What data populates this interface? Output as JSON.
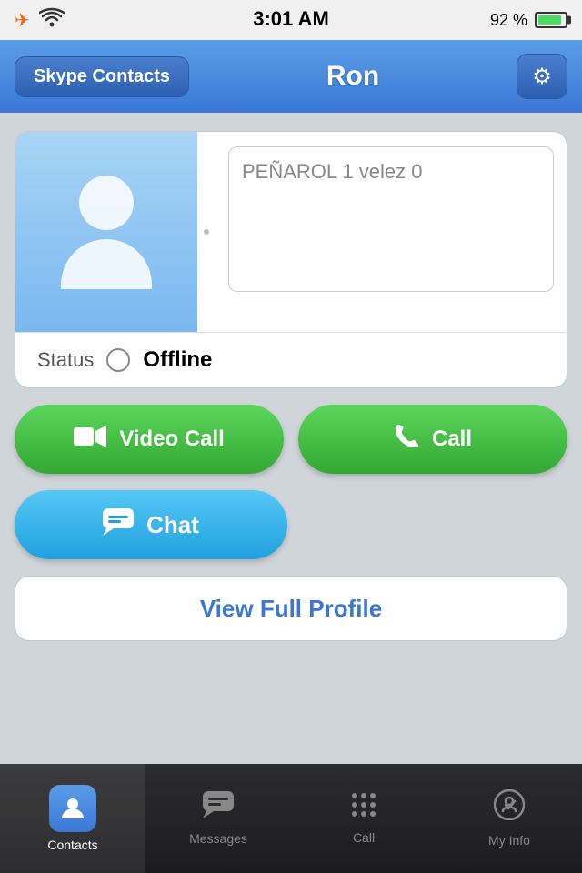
{
  "statusBar": {
    "time": "3:01 AM",
    "battery": "92 %"
  },
  "navBar": {
    "contactsButton": "Skype Contacts",
    "title": "Ron",
    "settingsIcon": "⚙"
  },
  "profile": {
    "statusNote": "PEÑAROL 1 velez 0",
    "statusLabel": "Status",
    "statusValue": "Offline"
  },
  "actions": {
    "videoCallLabel": "Video Call",
    "callLabel": "Call",
    "chatLabel": "Chat",
    "viewProfileLabel": "View Full Profile"
  },
  "tabBar": {
    "items": [
      {
        "id": "contacts",
        "label": "Contacts",
        "active": true
      },
      {
        "id": "messages",
        "label": "Messages",
        "active": false
      },
      {
        "id": "call",
        "label": "Call",
        "active": false
      },
      {
        "id": "myinfo",
        "label": "My Info",
        "active": false
      }
    ]
  }
}
